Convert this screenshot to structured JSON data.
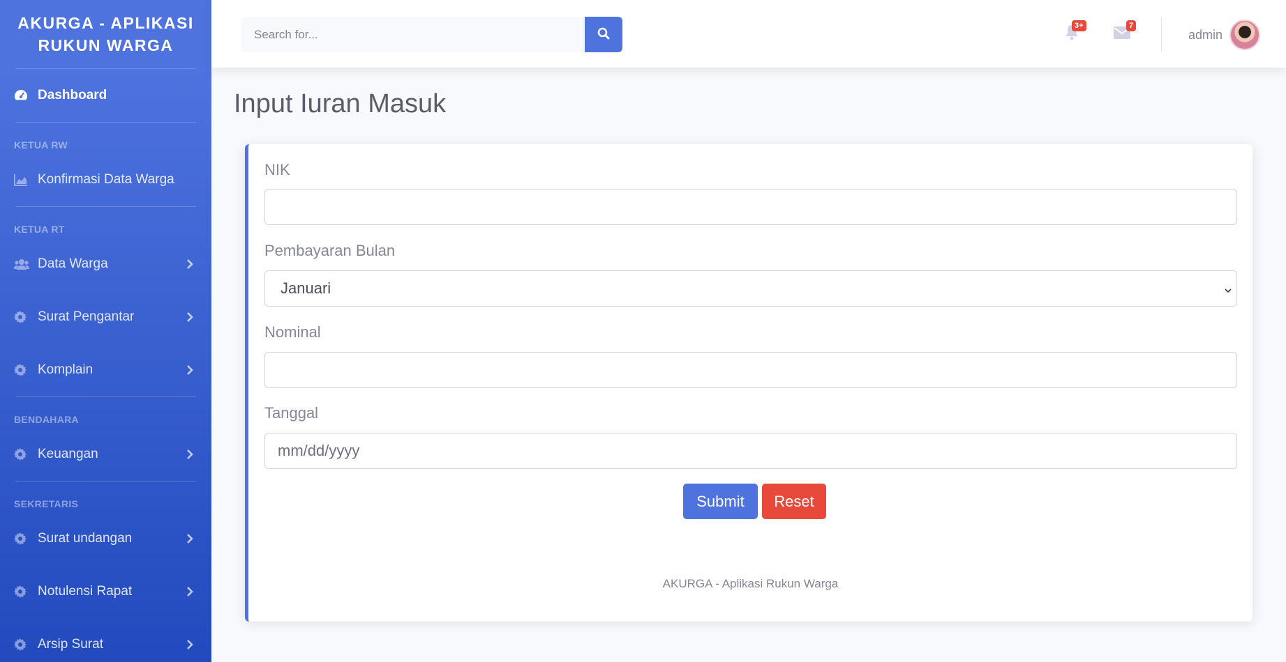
{
  "sidebar": {
    "brand": "AKURGA - APLIKASI RUKUN WARGA",
    "dashboard": "Dashboard",
    "headings": {
      "ketua_rw": "KETUA RW",
      "ketua_rt": "KETUA RT",
      "bendahara": "BENDAHARA",
      "sekretaris": "SEKRETARIS"
    },
    "items": {
      "konfirmasi": "Konfirmasi Data Warga",
      "data_warga": "Data Warga",
      "surat_pengantar": "Surat Pengantar",
      "komplain": "Komplain",
      "keuangan": "Keuangan",
      "surat_undangan": "Surat undangan",
      "notulensi": "Notulensi Rapat",
      "arsip": "Arsip Surat"
    }
  },
  "topbar": {
    "search_placeholder": "Search for...",
    "alerts_badge": "3+",
    "messages_badge": "7",
    "username": "admin"
  },
  "main": {
    "title": "Input Iuran Masuk",
    "form": {
      "nik_label": "NIK",
      "nik_value": "",
      "bulan_label": "Pembayaran Bulan",
      "bulan_value": "Januari",
      "nominal_label": "Nominal",
      "nominal_value": "",
      "tanggal_label": "Tanggal",
      "tanggal_placeholder": "mm/dd/yyyy",
      "submit_label": "Submit",
      "reset_label": "Reset"
    },
    "footer": "AKURGA - Aplikasi Rukun Warga"
  },
  "colors": {
    "primary": "#4e73df",
    "danger": "#e74a3b",
    "text_muted": "#858796"
  }
}
